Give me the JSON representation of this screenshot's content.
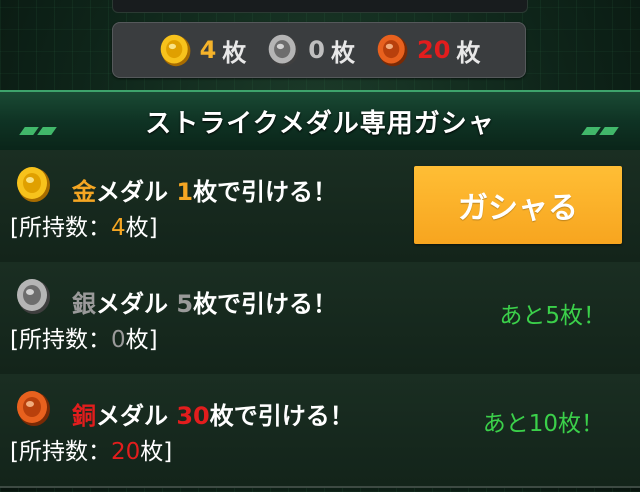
{
  "medal_bar": {
    "gold": {
      "count": "4",
      "unit": "枚",
      "icon": "gold-medal-icon"
    },
    "silver": {
      "count": "0",
      "unit": "枚",
      "icon": "silver-medal-icon"
    },
    "bronze": {
      "count": "20",
      "unit": "枚",
      "icon": "bronze-medal-icon"
    }
  },
  "header": {
    "title": "ストライクメダル専用ガシャ"
  },
  "rows": [
    {
      "metal": "金",
      "suffix": "メダル ",
      "cost": "1",
      "cost_suffix": "枚で引ける！",
      "owned_prefix": "[所持数：",
      "owned": "4",
      "owned_suffix": "枚]",
      "button_label": "ガシャる"
    },
    {
      "metal": "銀",
      "suffix": "メダル ",
      "cost": "5",
      "cost_suffix": "枚で引ける！",
      "owned_prefix": "[所持数：",
      "owned": "0",
      "owned_suffix": "枚]",
      "remaining": "あと5枚！"
    },
    {
      "metal": "銅",
      "suffix": "メダル ",
      "cost": "30",
      "cost_suffix": "枚で引ける！",
      "owned_prefix": "[所持数：",
      "owned": "20",
      "owned_suffix": "枚]",
      "remaining": "あと10枚！"
    }
  ],
  "colors": {
    "gold": "#f5a623",
    "silver": "#9a9a9a",
    "bronze": "#e21d1d",
    "button": "#f7a51f",
    "remaining": "#3bd04a"
  }
}
